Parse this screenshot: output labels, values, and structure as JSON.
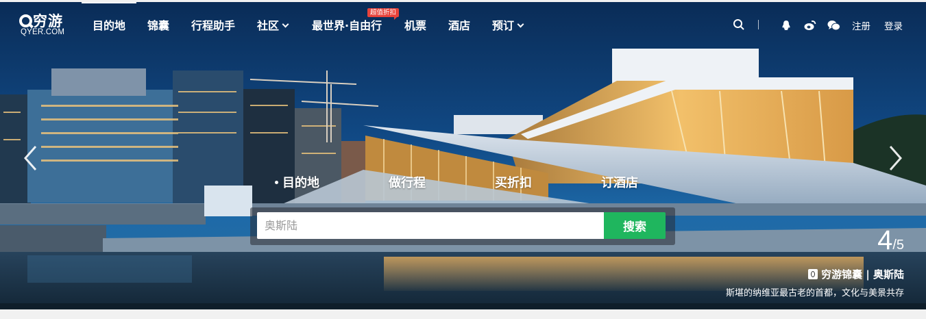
{
  "brand": {
    "logo_main": "穷游",
    "logo_sub": "QYER.COM"
  },
  "nav": {
    "items": [
      {
        "label": "目的地"
      },
      {
        "label": "锦囊"
      },
      {
        "label": "行程助手"
      },
      {
        "label": "社区"
      },
      {
        "label": "最世界·自由行",
        "badge": "超值折扣"
      },
      {
        "label": "机票"
      },
      {
        "label": "酒店"
      },
      {
        "label": "预订"
      }
    ]
  },
  "tools": {
    "register": "注册",
    "login": "登录",
    "icons": [
      "search-icon",
      "qq-icon",
      "weibo-icon",
      "wechat-icon"
    ]
  },
  "hero": {
    "tabs": [
      {
        "label": "目的地",
        "active": true
      },
      {
        "label": "做行程"
      },
      {
        "label": "买折扣"
      },
      {
        "label": "订酒店"
      }
    ],
    "search": {
      "placeholder": "奥斯陆",
      "button": "搜索"
    },
    "slide": {
      "current": "4",
      "sep": "/",
      "total": "5"
    },
    "caption": {
      "title": "穷游锦囊 | 奥斯陆",
      "desc": "斯堪的纳维亚最古老的首都，文化与美景共存"
    }
  },
  "colors": {
    "search_button": "#1fb65e",
    "promo_badge": "#e8433b",
    "sky": "#0d3a6b"
  }
}
